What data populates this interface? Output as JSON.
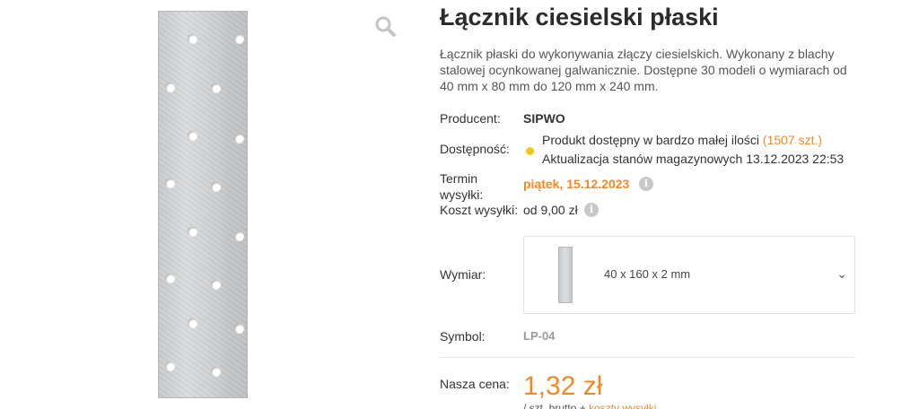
{
  "gallery": {
    "zoom_icon": "magnifier-icon",
    "image_alt": "Łącznik ciesielski płaski"
  },
  "product": {
    "title": "Łącznik ciesielski płaski",
    "description": "Łącznik płaski do wykonywania złączy ciesielskich. Wykonany z blachy stalowej ocynkowanej galwanicznie. Dostępne 30 modeli o wymiarach od 40 mm x 80 mm do 120 mm x 240 mm."
  },
  "details": {
    "producer_label": "Producent:",
    "producer_value": "SIPWO",
    "availability_label": "Dostępność:",
    "availability_text": "Produkt dostępny w bardzo małej ilości",
    "availability_qty": "(1507 szt.)",
    "availability_update": "Aktualizacja stanów magazynowych 13.12.2023 22:53",
    "availability_color": "#f5c518",
    "shipping_term_label_1": "Termin",
    "shipping_term_label_2": "wysyłki:",
    "shipping_term_value": "piątek, 15.12.2023",
    "shipping_cost_label": "Koszt wysyłki:",
    "shipping_cost_value": "od 9,00 zł",
    "info_icon": "i",
    "dimension_label": "Wymiar:",
    "dimension_value": "40 x 160 x 2 mm",
    "dimension_chevron": "⌄",
    "symbol_label": "Symbol:",
    "symbol_value": "LP-04"
  },
  "pricing": {
    "label": "Nasza cena:",
    "price": "1,32 zł",
    "sub_prefix": "/ szt. brutto + ",
    "sub_link": "koszty wysyłki",
    "accent": "#f08a24"
  }
}
